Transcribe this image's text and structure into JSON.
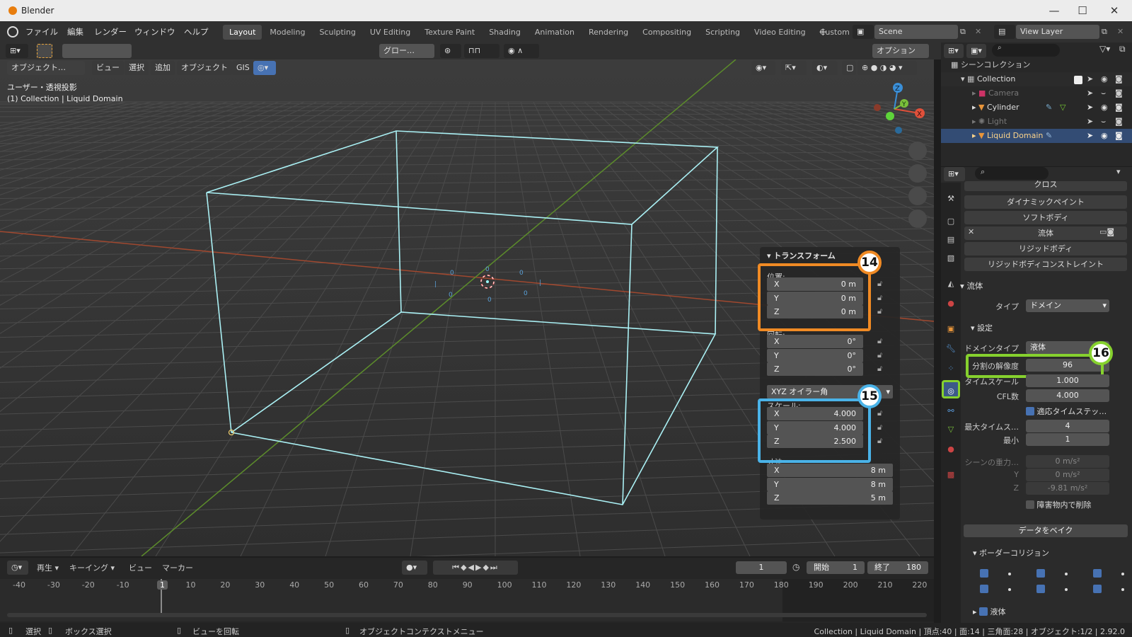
{
  "window": {
    "title": "Blender"
  },
  "menu": [
    "ファイル",
    "編集",
    "レンダー",
    "ウィンドウ",
    "ヘルプ"
  ],
  "workspaces": [
    "Layout",
    "Modeling",
    "Sculpting",
    "UV Editing",
    "Texture Paint",
    "Shading",
    "Animation",
    "Rendering",
    "Compositing",
    "Scripting",
    "Video Editing",
    "Custom"
  ],
  "active_workspace": "Layout",
  "scene": "Scene",
  "view_layer": "View Layer",
  "toolbar": {
    "transform_orientation": "グロー…",
    "options": "オプション"
  },
  "viewport_header": {
    "mode": "オブジェクト…",
    "view": "ビュー",
    "select": "選択",
    "add": "追加",
    "object": "オブジェクト",
    "gis": "GIS"
  },
  "viewport_info": {
    "line1": "ユーザー・透視投影",
    "line2": "(1) Collection | Liquid Domain"
  },
  "transform_panel": {
    "title": "トランスフォーム",
    "location_label": "位置:",
    "location": [
      {
        "axis": "X",
        "value": "0 m"
      },
      {
        "axis": "Y",
        "value": "0 m"
      },
      {
        "axis": "Z",
        "value": "0 m"
      }
    ],
    "rotation_label": "回転:",
    "rotation": [
      {
        "axis": "X",
        "value": "0°"
      },
      {
        "axis": "Y",
        "value": "0°"
      },
      {
        "axis": "Z",
        "value": "0°"
      }
    ],
    "rotation_mode": "XYZ オイラー角",
    "scale_label": "スケール:",
    "scale": [
      {
        "axis": "X",
        "value": "4.000"
      },
      {
        "axis": "Y",
        "value": "4.000"
      },
      {
        "axis": "Z",
        "value": "2.500"
      }
    ],
    "dimensions_label": "寸法:",
    "dimensions": [
      {
        "axis": "X",
        "value": "8 m"
      },
      {
        "axis": "Y",
        "value": "8 m"
      },
      {
        "axis": "Z",
        "value": "5 m"
      }
    ]
  },
  "callouts": {
    "c14": "14",
    "c15": "15",
    "c16": "16",
    "c14_color": "#f08a24",
    "c15_color": "#4ab3e8",
    "c16_color": "#86d12e"
  },
  "outliner": {
    "header": "シーンコレクション",
    "items": [
      {
        "name": "Collection"
      },
      {
        "name": "Camera"
      },
      {
        "name": "Cylinder"
      },
      {
        "name": "Light"
      },
      {
        "name": "Liquid Domain"
      }
    ]
  },
  "physics": {
    "buttons": [
      "クロス",
      "ダイナミックペイント",
      "ソフトボディ",
      "流体",
      "リジッドボディ",
      "リジッドボディコンストレイント"
    ],
    "section": "流体",
    "type_label": "タイプ",
    "type_value": "ドメイン",
    "settings": "設定",
    "domain_type_label": "ドメインタイプ",
    "domain_type_value": "液体",
    "resolution_label": "分割の解像度",
    "resolution_value": "96",
    "timescale_label": "タイムスケール",
    "timescale_value": "1.000",
    "cfl_label": "CFL数",
    "cfl_value": "4.000",
    "adaptive_label": "適応タイムステッ…",
    "max_label": "最大タイムス…",
    "max_value": "4",
    "min_label": "最小",
    "min_value": "1",
    "gravity_label": "シーンの重力…",
    "gravity": [
      "0 m/s²",
      "0 m/s²",
      "-9.81 m/s²"
    ],
    "gravity_y": "Y",
    "gravity_z": "Z",
    "delete_label": "障害物内で削除",
    "bake": "データをベイク",
    "border": "ボーダーコリジョン",
    "liquid": "液体"
  },
  "timeline": {
    "playback": "再生",
    "keying": "キーイング",
    "view": "ビュー",
    "marker": "マーカー",
    "current_frame": "1",
    "start_label": "開始",
    "start": "1",
    "end_label": "終了",
    "end": "180",
    "ticks": [
      "-40",
      "-30",
      "-20",
      "-10",
      "1",
      "10",
      "20",
      "30",
      "40",
      "50",
      "60",
      "70",
      "80",
      "90",
      "100",
      "110",
      "120",
      "130",
      "140",
      "150",
      "160",
      "170",
      "180",
      "190",
      "200",
      "210",
      "220"
    ]
  },
  "status": {
    "select": "選択",
    "box_select": "ボックス選択",
    "rotate": "ビューを回転",
    "context": "オブジェクトコンテクストメニュー",
    "info": "Collection | Liquid Domain | 頂点:40 | 面:14 | 三角面:28 | オブジェクト:1/2 | 2.92.0"
  }
}
